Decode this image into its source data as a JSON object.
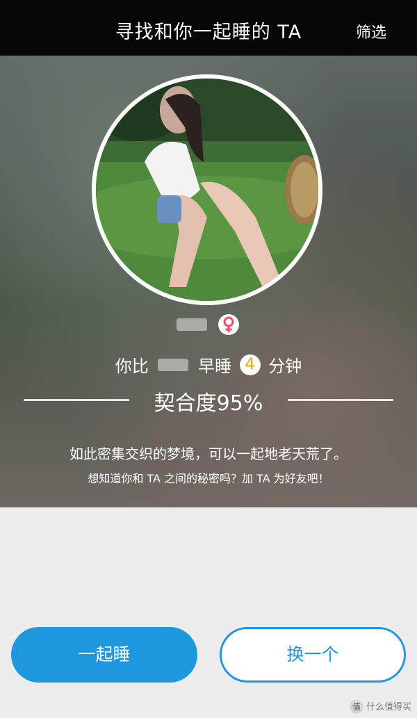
{
  "header": {
    "title": "寻找和你一起睡的 TA",
    "filter_label": "筛选"
  },
  "profile": {
    "gender_icon": "female-symbol-icon",
    "compare_prefix": "你比",
    "compare_middle": "早睡",
    "minutes": "4",
    "compare_suffix": "分钟",
    "match_text": "契合度95%",
    "desc_line1": "如此密集交织的梦境，可以一起地老天荒了。",
    "desc_line2": "想知道你和 TA 之间的秘密吗？加 TA 为好友吧！"
  },
  "actions": {
    "sleep_together": "一起睡",
    "next_one": "换一个"
  },
  "watermark": {
    "text": "什么值得买",
    "badge": "值"
  },
  "colors": {
    "accent": "#1d97de",
    "gender": "#f04e75",
    "minutes": "#f2a100"
  }
}
